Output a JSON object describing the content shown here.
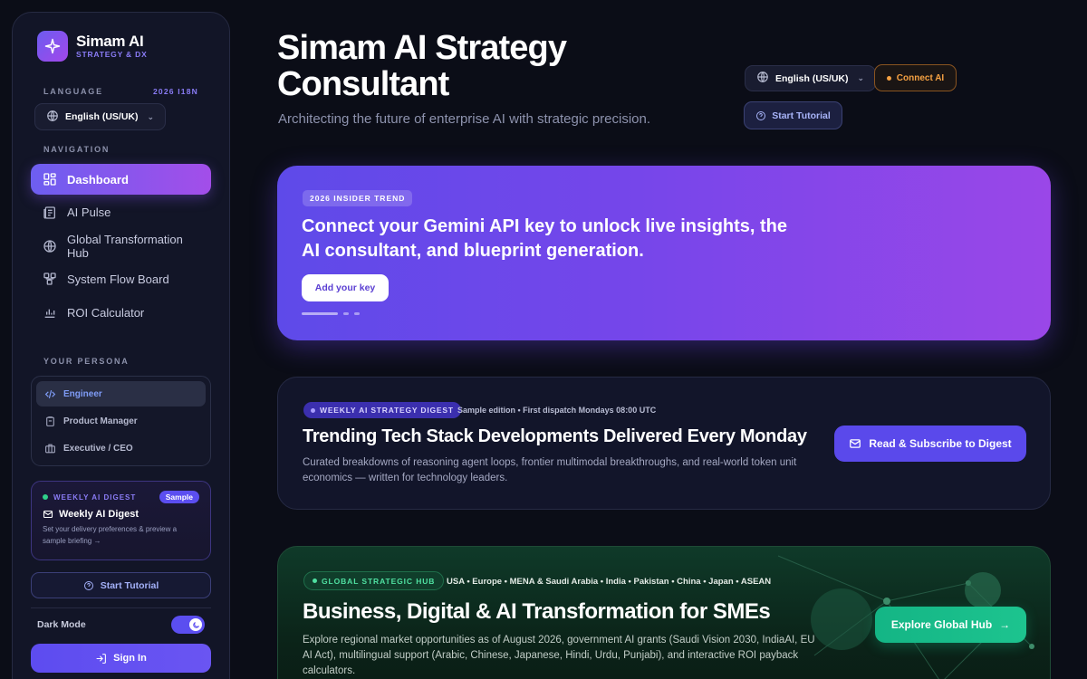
{
  "brand": {
    "name": "Simam AI",
    "tagline": "STRATEGY & DX"
  },
  "sidebar": {
    "language_label": "LANGUAGE",
    "i18n_tag": "2026 I18N",
    "language_value": "English (US/UK)",
    "navigation_label": "NAVIGATION",
    "nav_items": [
      {
        "label": "Dashboard",
        "icon": "dashboard-icon",
        "active": true
      },
      {
        "label": "AI Pulse",
        "icon": "newspaper-icon",
        "active": false
      },
      {
        "label": "Global Transformation Hub",
        "icon": "globe-icon",
        "active": false
      },
      {
        "label": "System Flow Board",
        "icon": "flow-icon",
        "active": false
      },
      {
        "label": "ROI Calculator",
        "icon": "bar-chart-icon",
        "active": false
      }
    ],
    "persona_label": "YOUR PERSONA",
    "personas": [
      {
        "label": "Engineer",
        "icon": "code-icon",
        "active": true
      },
      {
        "label": "Product Manager",
        "icon": "clipboard-icon",
        "active": false
      },
      {
        "label": "Executive / CEO",
        "icon": "briefcase-icon",
        "active": false
      }
    ],
    "digest": {
      "kicker": "WEEKLY AI DIGEST",
      "badge": "Sample",
      "title": "Weekly AI Digest",
      "description": "Set your delivery preferences & preview a sample briefing →"
    },
    "tutorial_label": "Start Tutorial",
    "dark_mode_label": "Dark Mode",
    "dark_mode_on": true,
    "sign_in_label": "Sign In"
  },
  "header": {
    "title": "Simam AI Strategy Consultant",
    "subtitle": "Architecting the future of enterprise AI with strategic precision.",
    "language_value": "English (US/UK)",
    "connect_label": "Connect AI",
    "tutorial_label": "Start Tutorial"
  },
  "hero": {
    "badge": "2026 INSIDER TREND",
    "text": "Connect your Gemini API key to unlock live insights, the AI consultant, and blueprint generation.",
    "button_label": "Add your key"
  },
  "weekly_digest": {
    "badge": "WEEKLY AI STRATEGY DIGEST",
    "meta": "Sample edition • First dispatch Mondays 08:00 UTC",
    "title": "Trending Tech Stack Developments Delivered Every Monday",
    "description": "Curated breakdowns of reasoning agent loops, frontier multimodal breakthroughs, and real-world token unit economics — written for technology leaders.",
    "cta_label": "Read & Subscribe to Digest"
  },
  "global_hub": {
    "badge": "GLOBAL STRATEGIC HUB",
    "regions": "USA • Europe • MENA & Saudi Arabia • India • Pakistan • China • Japan • ASEAN",
    "title": "Business, Digital & AI Transformation for SMEs",
    "description": "Explore regional market opportunities as of August 2026, government AI grants (Saudi Vision 2030, IndiaAI, EU AI Act), multilingual support (Arabic, Chinese, Japanese, Hindi, Urdu, Punjabi), and interactive ROI payback calculators.",
    "cta_label": "Explore Global Hub"
  },
  "colors": {
    "background": "#0b0d17",
    "accent_purple": "#7546ea",
    "accent_indigo": "#5a49eb",
    "accent_green": "#14b585",
    "accent_orange": "#f5a142"
  }
}
